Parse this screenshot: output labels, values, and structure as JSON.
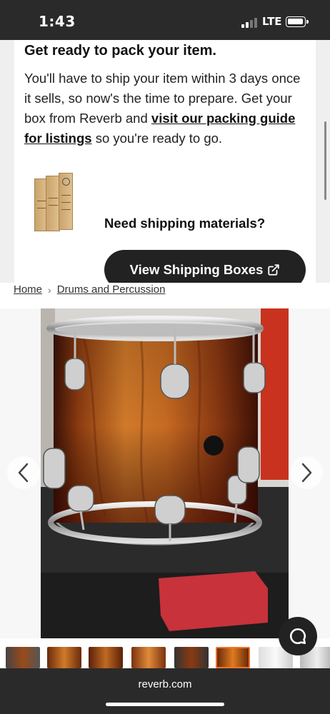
{
  "status": {
    "time": "1:43",
    "network": "LTE"
  },
  "card": {
    "title": "Get ready to pack your item.",
    "body_part1": "You'll have to ship your item within 3 days once it sells, so now's the time to prepare. Get your box from Reverb and ",
    "link_text": "visit our packing guide for listings",
    "body_part2": " so you're ready to go.",
    "shipping_question": "Need shipping materials?",
    "view_button_label": "View Shipping Boxes"
  },
  "breadcrumb": {
    "home": "Home",
    "category": "Drums and Percussion"
  },
  "gallery": {
    "thumbnail_count": 9,
    "active_index": 5
  },
  "browser": {
    "url": "reverb.com"
  },
  "colors": {
    "accent_active_thumb": "#f0732a",
    "button_dark": "#222222"
  },
  "icons": [
    "external-link-icon",
    "chevron-left-icon",
    "chevron-right-icon",
    "chat-icon"
  ]
}
